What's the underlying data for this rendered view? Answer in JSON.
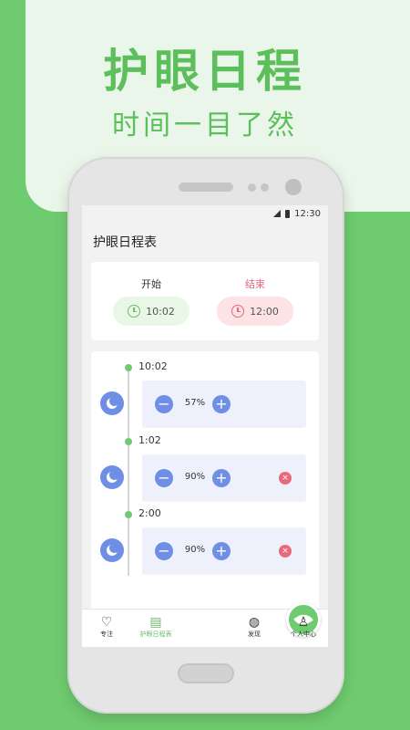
{
  "promo": {
    "title": "护眼日程",
    "subtitle": "时间一目了然"
  },
  "status_bar": {
    "time": "12:30"
  },
  "page": {
    "title": "护眼日程表"
  },
  "time_range": {
    "start_label": "开始",
    "end_label": "结束",
    "start_time": "10:02",
    "end_time": "12:00"
  },
  "schedule": [
    {
      "time": "10:02",
      "percent": "57%",
      "deletable": false
    },
    {
      "time": "1:02",
      "percent": "90%",
      "deletable": true
    },
    {
      "time": "2:00",
      "percent": "90%",
      "deletable": true
    }
  ],
  "controls": {
    "minus": "−",
    "plus": "+",
    "delete": "×"
  },
  "tabs": [
    {
      "label": "专注",
      "icon": "heart-icon"
    },
    {
      "label": "护眼日程表",
      "icon": "calendar-icon"
    },
    {
      "label": "",
      "icon": "leaf-icon"
    },
    {
      "label": "发现",
      "icon": "planet-icon"
    },
    {
      "label": "个人中心",
      "icon": "person-icon"
    }
  ],
  "colors": {
    "background_green": "#6fcb6f",
    "accent_blue": "#6f8fe6",
    "accent_red": "#e86a7a"
  }
}
